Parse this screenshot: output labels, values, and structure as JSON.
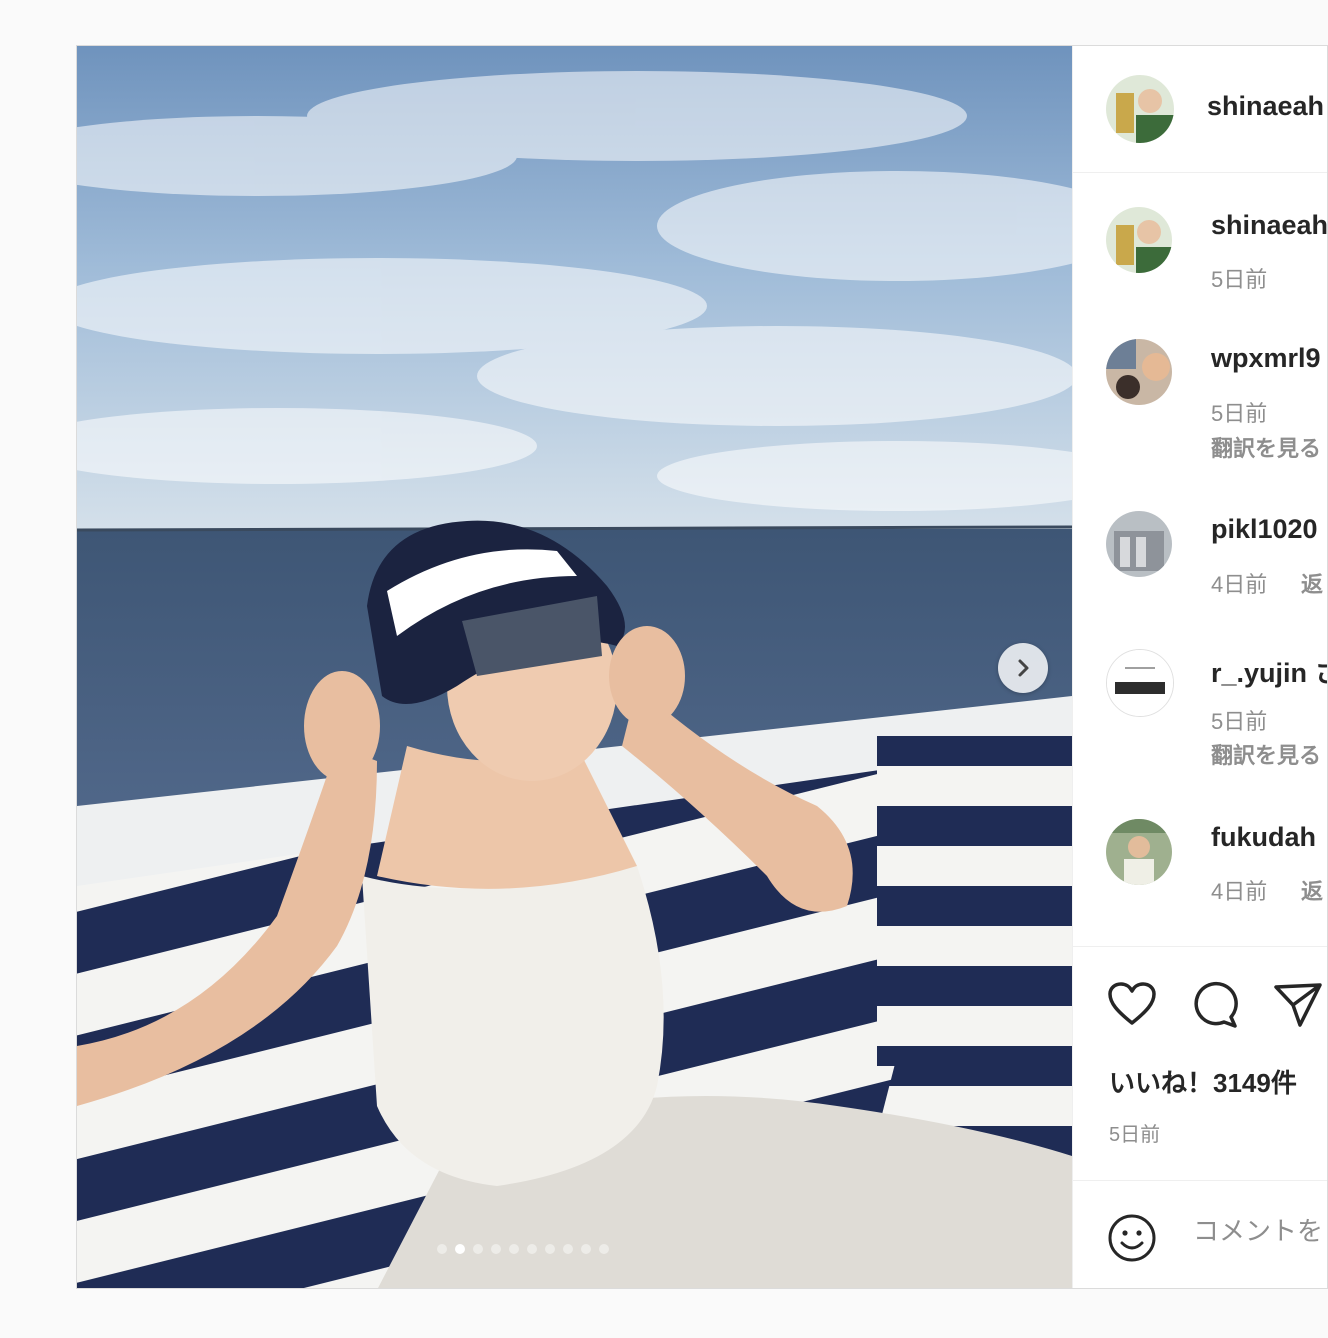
{
  "post": {
    "author": "shinaeah",
    "next_icon": "chevron-right-icon",
    "carousel_dots": [
      true,
      false,
      false,
      false,
      false,
      false,
      false,
      false,
      false,
      false
    ]
  },
  "comments": [
    {
      "username": "shinaeah",
      "time": "5日前",
      "action": "",
      "translate": ""
    },
    {
      "username": "wpxmrl9",
      "time": "5日前",
      "action": "「",
      "translate": "翻訳を見る"
    },
    {
      "username": "pikl1020",
      "time": "4日前",
      "action": "返",
      "translate": ""
    },
    {
      "username": "r_.yujin",
      "suffix": "さ",
      "time": "5日前",
      "action": "「",
      "translate": "翻訳を見る"
    },
    {
      "username": "fukudah",
      "time": "4日前",
      "action": "返",
      "translate": ""
    }
  ],
  "actions": {
    "like_icon": "heart-icon",
    "comment_icon": "comment-icon",
    "share_icon": "send-icon",
    "likes_text": "いいね！3149件",
    "posted": "5日前"
  },
  "comment_box": {
    "emoji_icon": "smiley-icon",
    "placeholder": "コメントを"
  }
}
